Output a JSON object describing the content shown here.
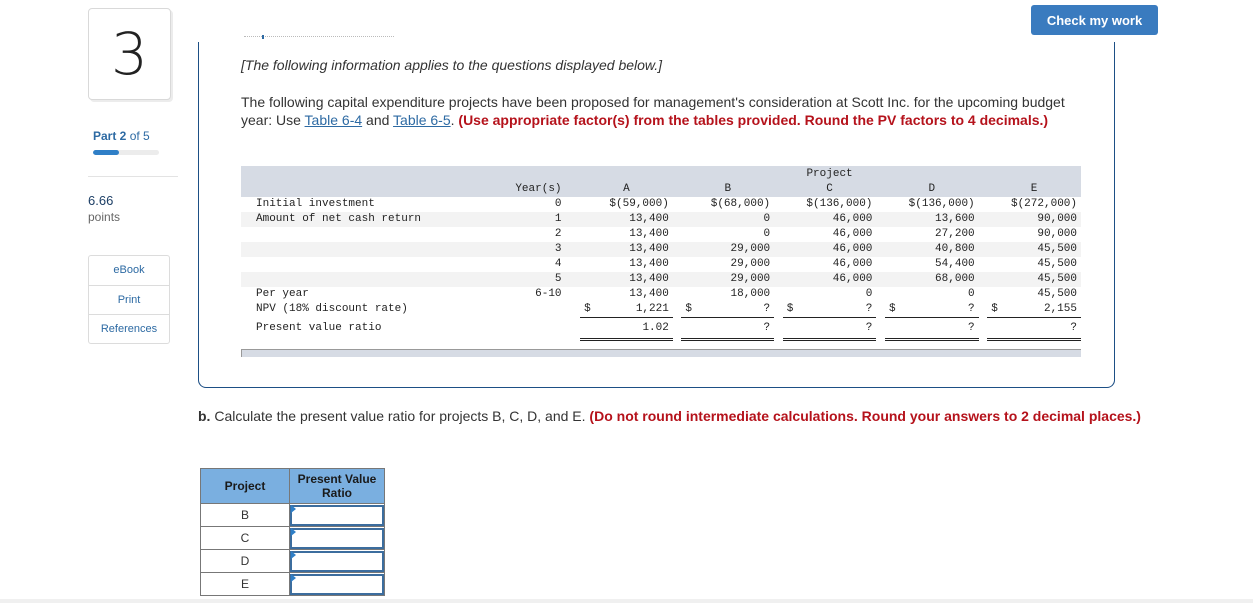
{
  "question": {
    "number": "3",
    "part_label_bold": "Part 2",
    "part_label_rest": " of 5",
    "part_progress_fraction": 0.4,
    "points_value": "6.66",
    "points_label": "points"
  },
  "sidebar": {
    "links": [
      {
        "label": "eBook",
        "icon": "ebook"
      },
      {
        "label": "Print",
        "icon": "print"
      },
      {
        "label": "References",
        "icon": "references"
      }
    ]
  },
  "header": {
    "check_button": "Check my work"
  },
  "intro": {
    "italic_note": "[The following information applies to the questions displayed below.]",
    "para_start": "The following capital expenditure projects have been proposed for management's consideration at Scott Inc. for the upcoming budget year: Use ",
    "link1": "Table 6-4",
    "para_mid": " and ",
    "link2": "Table 6-5",
    "para_end": ". ",
    "instruction_red": "(Use appropriate factor(s) from the tables provided. Round the PV factors to 4 decimals.)"
  },
  "data_table": {
    "group_header": "Project",
    "year_header": "Year(s)",
    "project_headers": [
      "A",
      "B",
      "C",
      "D",
      "E"
    ],
    "rows": [
      {
        "label": "Initial investment",
        "year": "0",
        "values": [
          "$(59,000)",
          "$(68,000)",
          "$(136,000)",
          "$(136,000)",
          "$(272,000)"
        ]
      },
      {
        "label": "Amount of net cash return",
        "year": "1",
        "values": [
          "13,400",
          "0",
          "46,000",
          "13,600",
          "90,000"
        ]
      },
      {
        "label": "",
        "year": "2",
        "values": [
          "13,400",
          "0",
          "46,000",
          "27,200",
          "90,000"
        ]
      },
      {
        "label": "",
        "year": "3",
        "values": [
          "13,400",
          "29,000",
          "46,000",
          "40,800",
          "45,500"
        ]
      },
      {
        "label": "",
        "year": "4",
        "values": [
          "13,400",
          "29,000",
          "46,000",
          "54,400",
          "45,500"
        ]
      },
      {
        "label": "",
        "year": "5",
        "values": [
          "13,400",
          "29,000",
          "46,000",
          "68,000",
          "45,500"
        ]
      },
      {
        "label": "Per year",
        "year": "6-10",
        "values": [
          "13,400",
          "18,000",
          "0",
          "0",
          "45,500"
        ]
      }
    ],
    "npv_row": {
      "label": "NPV (18% discount rate)",
      "currency": "$",
      "values": [
        "1,221",
        "?",
        "?",
        "?",
        "2,155"
      ]
    },
    "pvr_row": {
      "label": "Present value ratio",
      "values": [
        "1.02",
        "?",
        "?",
        "?",
        "?"
      ]
    }
  },
  "question_b": {
    "prefix": "b.",
    "text": " Calculate the present value ratio for projects B, C, D, and E. ",
    "instruction_red": "(Do not round intermediate calculations. Round your answers to 2 decimal places.)"
  },
  "answer_table": {
    "col1_header": "Project",
    "col2_header": "Present Value Ratio",
    "rows": [
      {
        "project": "B",
        "value": ""
      },
      {
        "project": "C",
        "value": ""
      },
      {
        "project": "D",
        "value": ""
      },
      {
        "project": "E",
        "value": ""
      }
    ]
  }
}
